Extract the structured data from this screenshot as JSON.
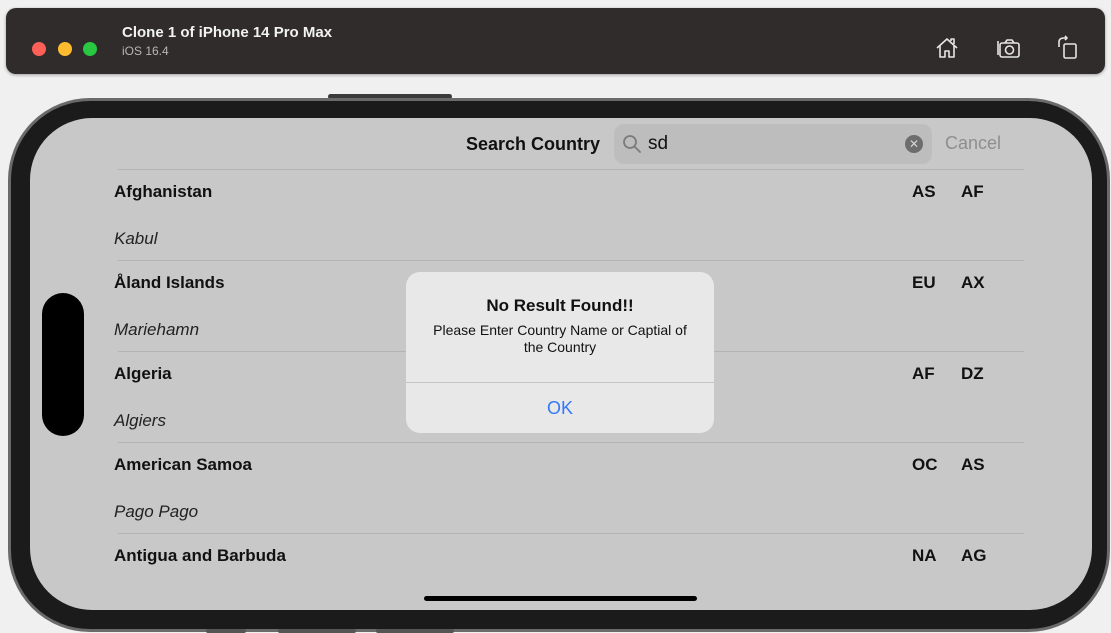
{
  "window": {
    "title": "Clone 1 of iPhone 14 Pro Max",
    "subtitle": "iOS 16.4",
    "toolbar_icons": [
      "home-icon",
      "screenshot-icon",
      "rotate-icon"
    ]
  },
  "nav": {
    "title": "Search Country",
    "search_value": "sd",
    "cancel_label": "Cancel"
  },
  "countries": [
    {
      "name": "Afghanistan",
      "capital": "Kabul",
      "continent": "AS",
      "code": "AF"
    },
    {
      "name": "Åland Islands",
      "capital": "Mariehamn",
      "continent": "EU",
      "code": "AX"
    },
    {
      "name": "Algeria",
      "capital": "Algiers",
      "continent": "AF",
      "code": "DZ"
    },
    {
      "name": "American Samoa",
      "capital": "Pago Pago",
      "continent": "OC",
      "code": "AS"
    },
    {
      "name": "Antigua and Barbuda",
      "capital": "",
      "continent": "NA",
      "code": "AG"
    }
  ],
  "alert": {
    "title": "No Result Found!!",
    "message": "Please Enter Country Name or Captial of the Country",
    "ok_label": "OK"
  },
  "colors": {
    "accent": "#3478f6",
    "titlebar": "#2f2c2b",
    "screen_bg": "#c8c8c8"
  }
}
